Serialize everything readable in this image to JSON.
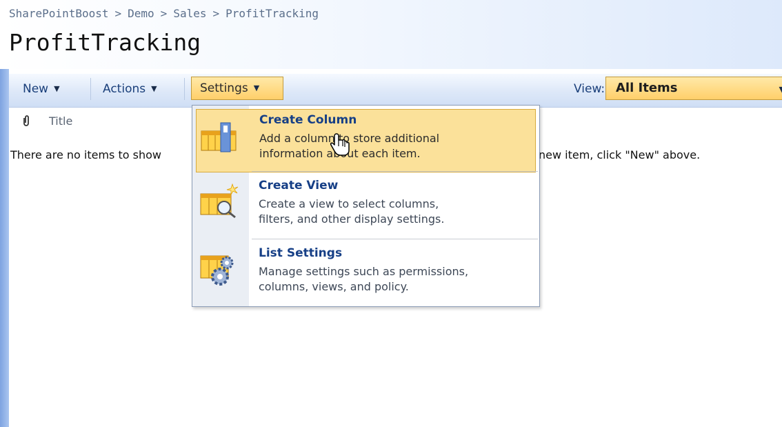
{
  "breadcrumb": [
    "SharePointBoost",
    "Demo",
    "Sales",
    "ProfitTracking"
  ],
  "breadcrumb_separator": ">",
  "page_title": "ProfitTracking",
  "toolbar": {
    "new_label": "New",
    "actions_label": "Actions",
    "settings_label": "Settings",
    "view_label": "View:",
    "view_value": "All Items"
  },
  "list": {
    "columns": [
      "Title"
    ],
    "empty_message_left": "There are no items to show",
    "empty_message_right": "new item, click \"New\" above."
  },
  "settings_menu": {
    "items": [
      {
        "title": "Create Column",
        "desc_line1": "Add a column to store additional",
        "desc_line2": "information about each item.",
        "icon": "create-column-icon",
        "highlighted": true
      },
      {
        "title": "Create View",
        "desc_line1": "Create a view to select columns,",
        "desc_line2": "filters, and other display settings.",
        "icon": "create-view-icon",
        "highlighted": false
      },
      {
        "title": "List Settings",
        "desc_line1": "Manage settings such as permissions,",
        "desc_line2": "columns, views, and policy.",
        "icon": "list-settings-icon",
        "highlighted": false
      }
    ]
  },
  "colors": {
    "highlight": "#fbe19a",
    "link_blue": "#163f86",
    "toolbar_text": "#1a3f7a"
  }
}
